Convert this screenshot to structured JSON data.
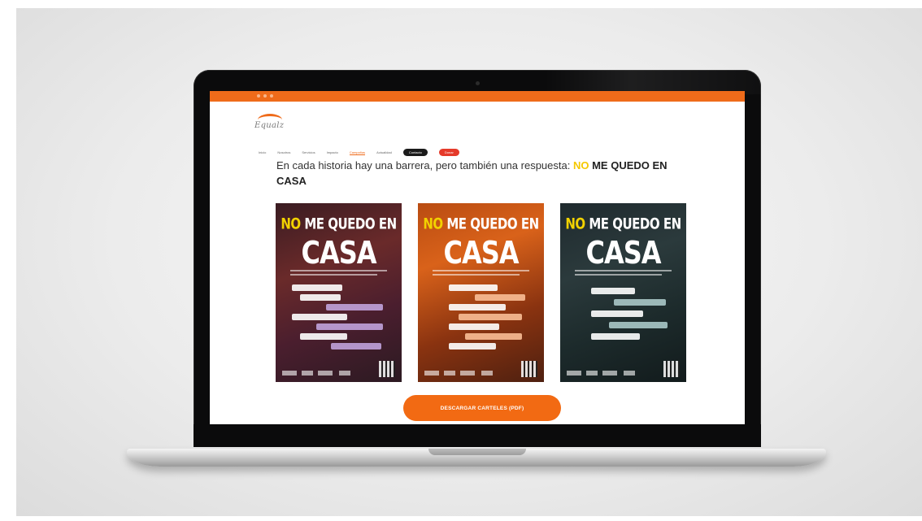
{
  "site": {
    "logo_text": "Equalz"
  },
  "nav": {
    "items": [
      {
        "label": "Inicio",
        "highlight": false
      },
      {
        "label": "Nosotros",
        "highlight": false
      },
      {
        "label": "Servicios",
        "highlight": false
      },
      {
        "label": "Impacto",
        "highlight": false
      },
      {
        "label": "Campañas",
        "highlight": true
      },
      {
        "label": "Actualidad",
        "highlight": false
      }
    ],
    "pill_dark": "Contacto",
    "pill_red": "Donar"
  },
  "intro": {
    "text": "En cada historia hay una barrera, pero también una respuesta:",
    "highlight_no": "NO",
    "highlight_rest": "ME QUEDO EN CASA"
  },
  "posters": [
    {
      "no": "NO",
      "head_rest": "ME QUEDO EN",
      "casa": "CASA",
      "theme": "purple"
    },
    {
      "no": "NO",
      "head_rest": "ME QUEDO EN",
      "casa": "CASA",
      "theme": "orange"
    },
    {
      "no": "NO",
      "head_rest": "ME QUEDO EN",
      "casa": "CASA",
      "theme": "teal"
    }
  ],
  "cta": {
    "label": "DESCARGAR CARTELES (PDF)"
  },
  "colors": {
    "brand_orange": "#ef6b1a",
    "accent_yellow": "#f2d200",
    "cta_orange": "#f26a13",
    "red_pill": "#e53a2a"
  }
}
